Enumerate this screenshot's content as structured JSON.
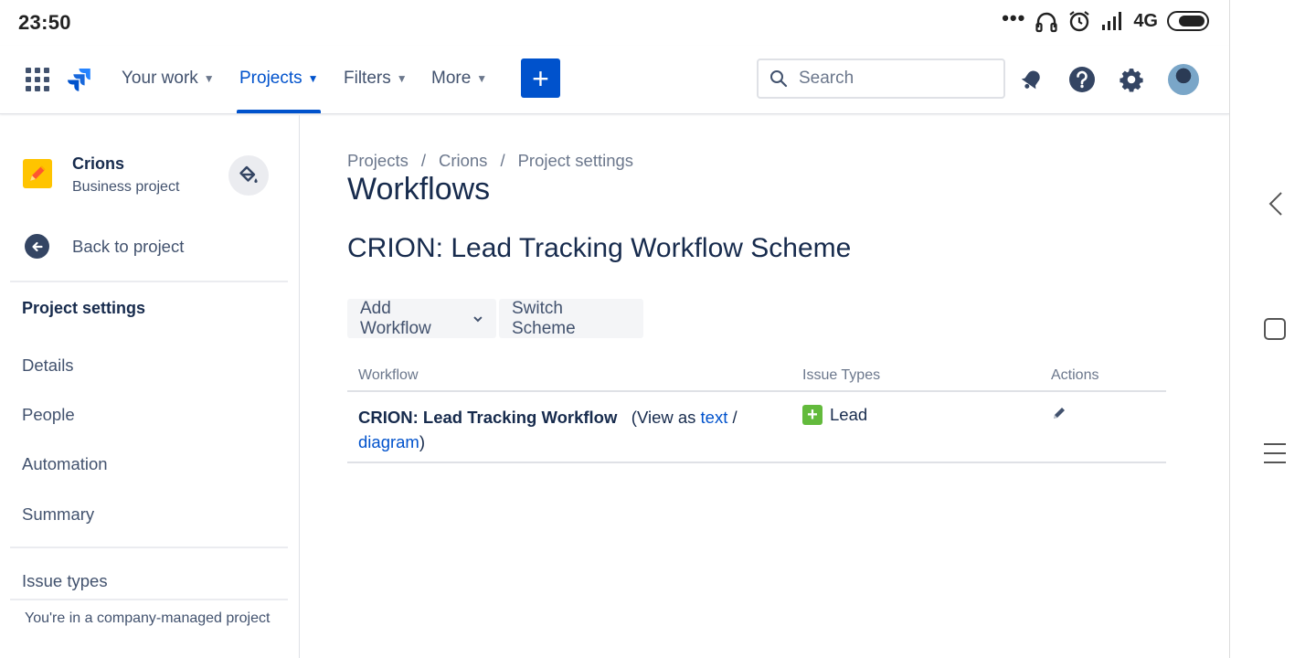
{
  "status_bar": {
    "time": "23:50",
    "dots": "•••",
    "network": "4G"
  },
  "topnav": {
    "items": [
      {
        "label": "Your work"
      },
      {
        "label": "Projects"
      },
      {
        "label": "Filters"
      },
      {
        "label": "More"
      }
    ],
    "create_label": "+",
    "search_placeholder": "Search"
  },
  "sidebar": {
    "project_name": "Crions",
    "project_type": "Business project",
    "back_label": "Back to project",
    "section_title": "Project settings",
    "items": [
      {
        "label": "Details"
      },
      {
        "label": "People"
      },
      {
        "label": "Automation"
      },
      {
        "label": "Summary"
      },
      {
        "label": "Issue types"
      }
    ],
    "footer": "You're in a company-managed project"
  },
  "main": {
    "breadcrumb": [
      "Projects",
      "Crions",
      "Project settings"
    ],
    "breadcrumb_sep": "/",
    "title": "Workflows",
    "scheme_title": "CRION: Lead Tracking Workflow Scheme",
    "buttons": {
      "add_workflow": "Add Workflow",
      "switch_scheme": "Switch Scheme"
    },
    "table": {
      "headers": {
        "workflow": "Workflow",
        "issue_types": "Issue Types",
        "actions": "Actions"
      },
      "row": {
        "workflow_name": "CRION: Lead Tracking Workflow",
        "view_as_prefix": "(View as",
        "text_link": "text",
        "slash": "/",
        "diagram_link": "diagram",
        "close_paren": ")",
        "issue_type": "Lead"
      }
    }
  },
  "colors": {
    "accent": "#0052cc",
    "text": "#172b4d",
    "subtle": "#42526e",
    "lead_icon": "#63ba3c",
    "project_avatar": "#ffc400"
  }
}
